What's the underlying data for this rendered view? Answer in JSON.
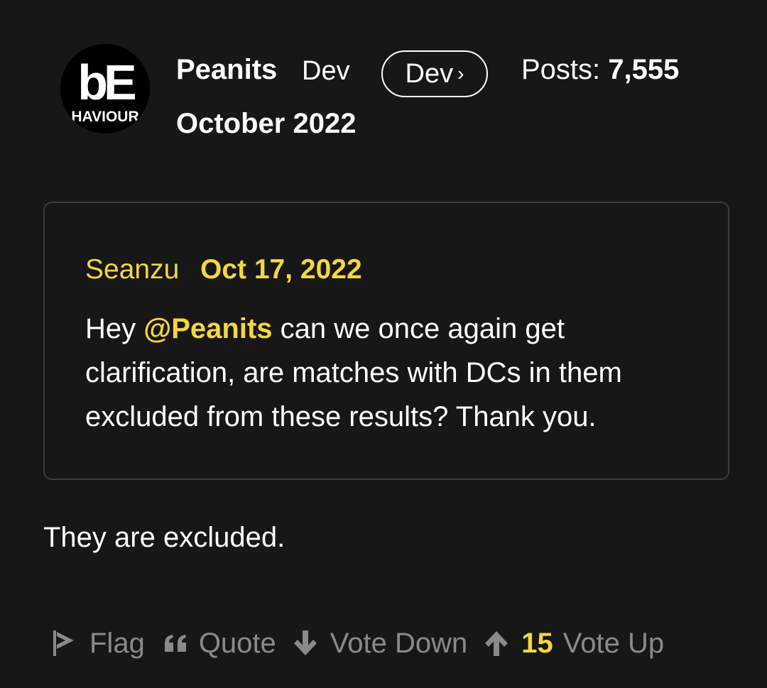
{
  "author": {
    "avatar_logo_top": "bE",
    "avatar_logo_bottom": "HAVIOUR",
    "name": "Peanits",
    "role": "Dev",
    "badge_label": "Dev",
    "badge_chevron": "›",
    "posts_label": "Posts:",
    "posts_count": "7,555"
  },
  "post": {
    "date": "October 2022",
    "reply_text": "They are excluded."
  },
  "quote": {
    "author": "Seanzu",
    "date": "Oct 17, 2022",
    "text_before": "Hey ",
    "mention": "@Peanits",
    "text_after": " can we once again get clarification, are matches with DCs in them excluded from these results? Thank you."
  },
  "actions": {
    "flag_label": "Flag",
    "flag_icon": "flag-icon",
    "quote_label": "Quote",
    "quote_icon": "quote-icon",
    "vote_down_label": "Vote Down",
    "vote_down_icon": "arrow-down-icon",
    "vote_up_count": "15",
    "vote_up_label": "Vote Up",
    "vote_up_icon": "arrow-up-icon"
  },
  "colors": {
    "background": "#171717",
    "accent": "#f5d63d",
    "muted": "#8a8a8a",
    "text": "#ffffff"
  }
}
